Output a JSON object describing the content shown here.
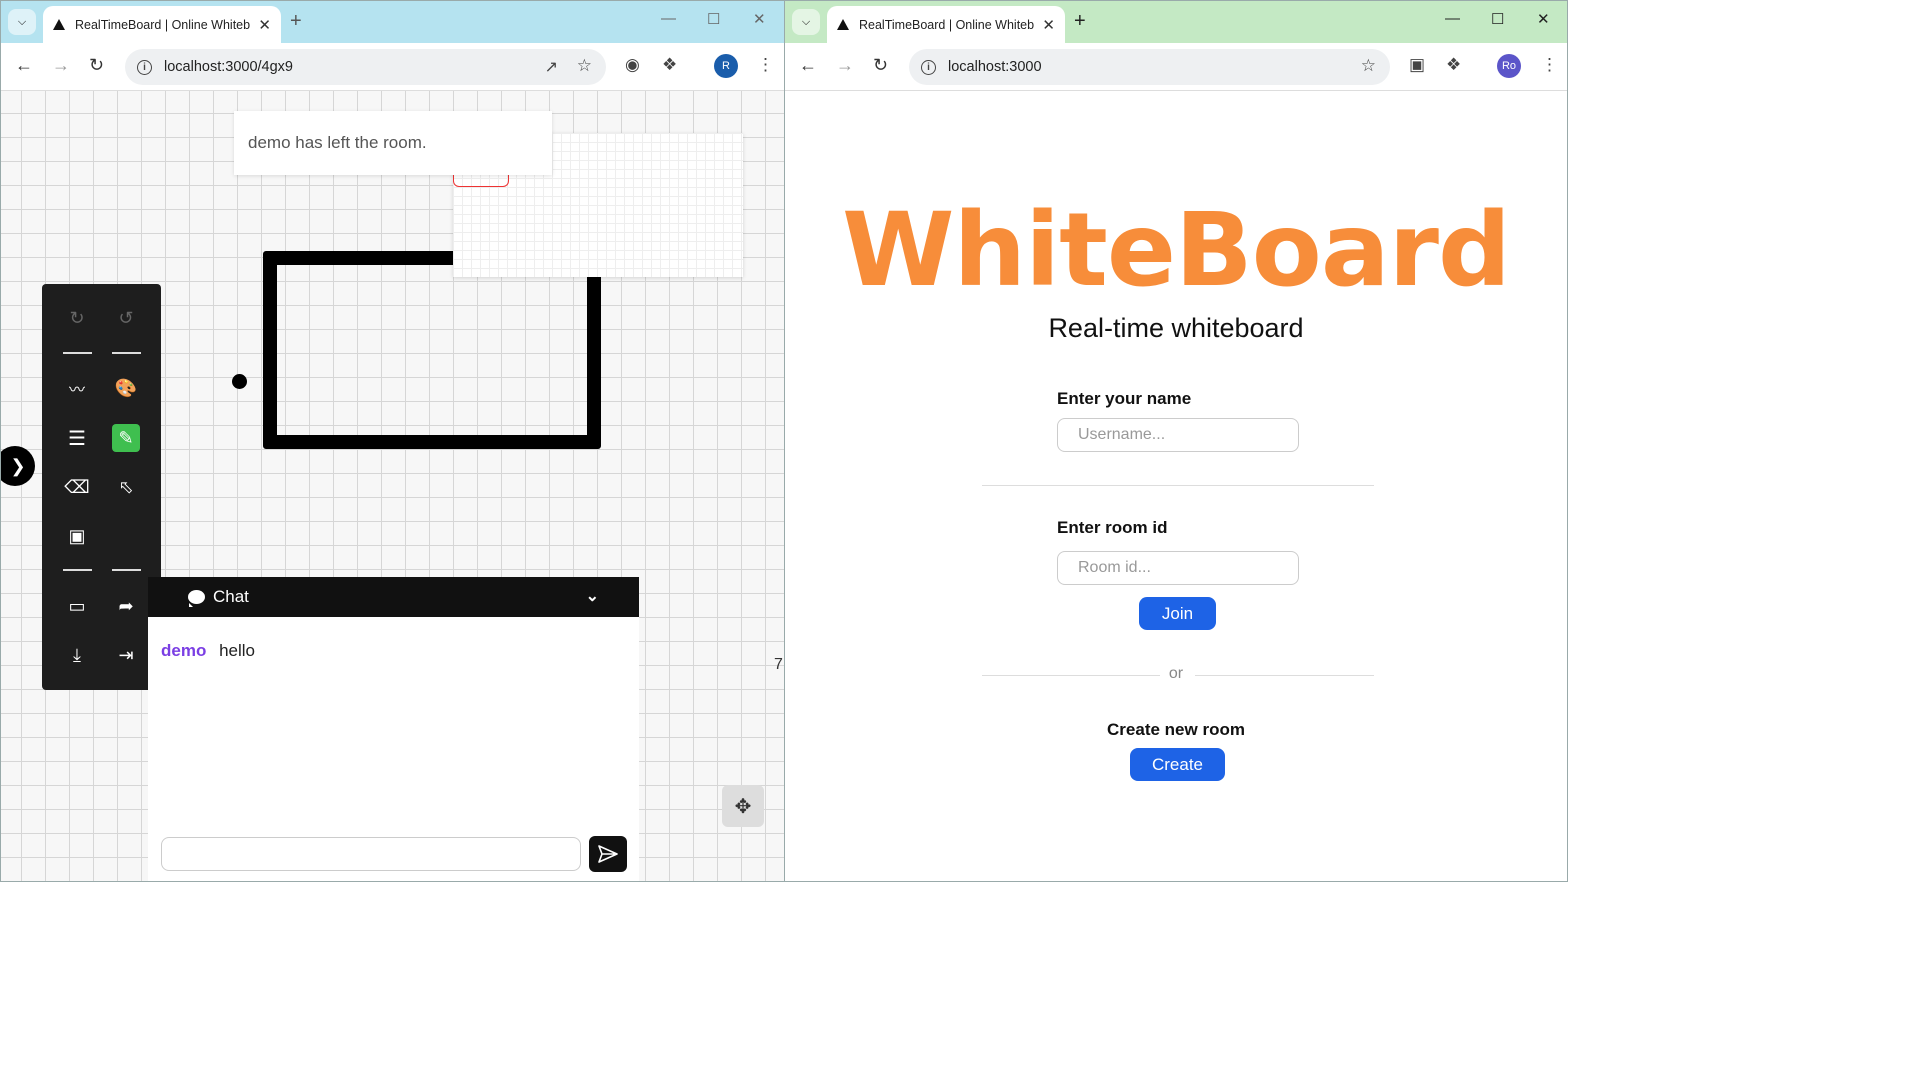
{
  "left_window": {
    "tab_title": "RealTimeBoard | Online Whiteb",
    "url": "localhost:3000/4gx9",
    "avatar_letter": "R",
    "avatar_color": "#1a5dab",
    "toast": "demo has left the room.",
    "chat": {
      "title": "Chat",
      "messages": [
        {
          "user": "demo",
          "text": "hello"
        }
      ],
      "input_value": ""
    },
    "edge_text": "7",
    "accent_active": "#3fbf4f"
  },
  "right_window": {
    "tab_title": "RealTimeBoard | Online Whiteb",
    "url": "localhost:3000",
    "avatar_letter": "Ro",
    "avatar_color": "#5b55c9",
    "logo": "WhiteBoard",
    "logo_color": "#f78d3a",
    "subtitle": "Real-time whiteboard",
    "name_label": "Enter your name",
    "name_placeholder": "Username...",
    "room_label": "Enter room id",
    "room_placeholder": "Room id...",
    "join_label": "Join",
    "or_label": "or",
    "create_heading": "Create new room",
    "create_label": "Create",
    "button_color": "#1e63e6"
  }
}
